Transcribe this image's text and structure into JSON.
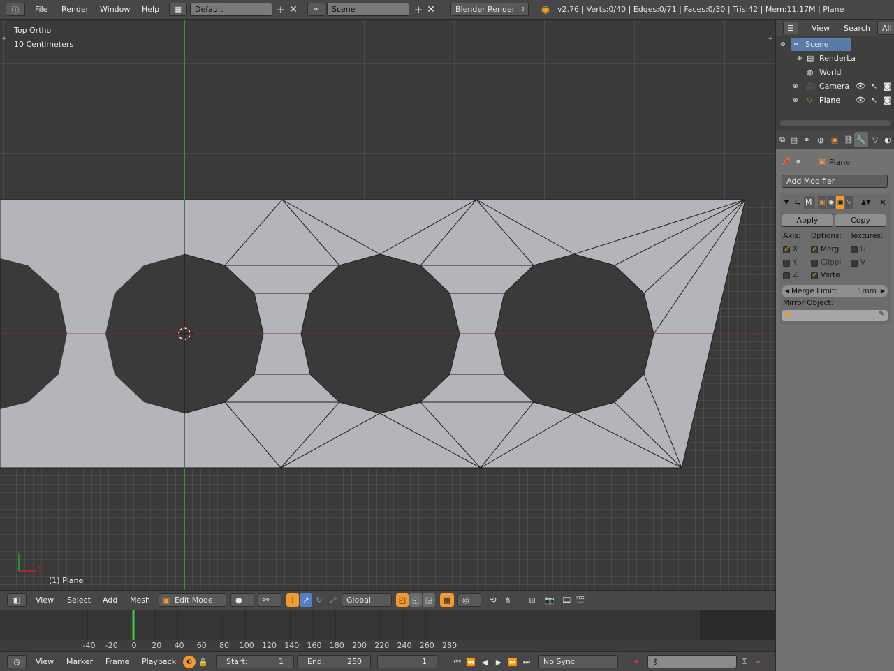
{
  "top_bar": {
    "menus": [
      "File",
      "Render",
      "Window",
      "Help"
    ],
    "layout_name": "Default",
    "scene_name": "Scene",
    "render_engine": "Blender Render",
    "stats": "v2.76 | Verts:0/40 | Edges:0/71 | Faces:0/30 | Tris:42 | Mem:11.17M | Plane"
  },
  "viewport": {
    "view_name": "Top Ortho",
    "scale_label": "10 Centimeters",
    "object_label": "(1) Plane",
    "axis_x": "x",
    "axis_y": "y"
  },
  "viewport_header": {
    "menus": [
      "View",
      "Select",
      "Add",
      "Mesh"
    ],
    "mode": "Edit Mode",
    "orientation": "Global"
  },
  "timeline": {
    "ticks": [
      "-40",
      "-20",
      "0",
      "20",
      "40",
      "60",
      "80",
      "100",
      "120",
      "140",
      "160",
      "180",
      "200",
      "220",
      "240",
      "260",
      "280"
    ],
    "current_frame_marker": 0
  },
  "timeline_header": {
    "menus": [
      "View",
      "Marker",
      "Frame",
      "Playback"
    ],
    "start_label": "Start:",
    "start_value": "1",
    "end_label": "End:",
    "end_value": "250",
    "current_frame": "1",
    "sync": "No Sync"
  },
  "outliner": {
    "tabs": [
      "View",
      "Search",
      "All"
    ],
    "items": [
      {
        "label": "Scene",
        "icon": "scene-icon"
      },
      {
        "label": "RenderLa",
        "icon": "render-layers-icon"
      },
      {
        "label": "World",
        "icon": "world-icon"
      },
      {
        "label": "Camera",
        "icon": "camera-icon"
      },
      {
        "label": "Plane",
        "icon": "mesh-icon"
      }
    ]
  },
  "properties": {
    "object_name": "Plane",
    "add_modifier": "Add Modifier",
    "modifier_short": "M",
    "apply_label": "Apply",
    "copy_label": "Copy",
    "axis_heading": "Axis:",
    "options_heading": "Options:",
    "textures_heading": "Textures:",
    "axis": [
      {
        "label": "X",
        "checked": true
      },
      {
        "label": "Y",
        "checked": false
      },
      {
        "label": "Z",
        "checked": false
      }
    ],
    "options": [
      {
        "label": "Merg",
        "checked": true
      },
      {
        "label": "Clippi",
        "checked": false
      },
      {
        "label": "Verte",
        "checked": true
      }
    ],
    "textures": [
      {
        "label": "U",
        "checked": false
      },
      {
        "label": "V",
        "checked": false
      }
    ],
    "merge_limit_label": "Merge Limit:",
    "merge_limit_value": "1mm",
    "mirror_object_label": "Mirror Object:"
  },
  "colors": {
    "accent": "#f09a30",
    "selected_row": "#5a7aa8",
    "mesh_face": "#b4b5bb",
    "x_axis": "#9b2d2d",
    "y_axis": "#2d9b2d"
  }
}
